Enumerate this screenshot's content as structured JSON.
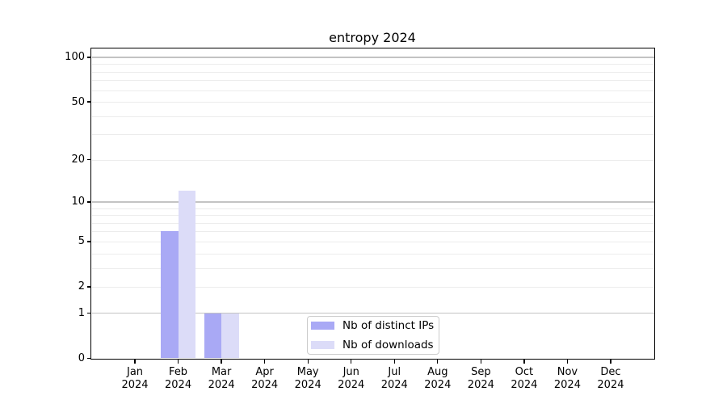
{
  "chart_data": {
    "type": "bar",
    "title": "entropy 2024",
    "categories": [
      "Jan",
      "Feb",
      "Mar",
      "Apr",
      "May",
      "Jun",
      "Jul",
      "Aug",
      "Sep",
      "Oct",
      "Nov",
      "Dec"
    ],
    "year_label": "2024",
    "series": [
      {
        "name": "Nb of distinct IPs",
        "color": "#a9a9f5",
        "values": [
          0,
          6,
          1,
          0,
          0,
          0,
          0,
          0,
          0,
          0,
          0,
          0
        ]
      },
      {
        "name": "Nb of downloads",
        "color": "#dcdcf8",
        "values": [
          0,
          12,
          1,
          0,
          0,
          0,
          0,
          0,
          0,
          0,
          0,
          0
        ]
      }
    ],
    "xlabel": "",
    "ylabel": "",
    "y_axis": {
      "scale": "log10(1+value)",
      "tick_labels": [
        "0",
        "1",
        "2",
        "5",
        "10",
        "20",
        "50",
        "100"
      ],
      "tick_values": [
        0,
        1,
        2,
        5,
        10,
        20,
        50,
        100
      ],
      "ylim": [
        0,
        114
      ]
    },
    "grid": {
      "orientation": "horizontal",
      "minor_color": "#ececec",
      "major_color": "#c3c3c3",
      "major_at": [
        1,
        10,
        100
      ]
    },
    "legend": {
      "position": "lower center"
    }
  },
  "colors": {
    "background": "#ffffff",
    "bar_distinct_ips": "#a9a9f5",
    "bar_downloads": "#dcdcf8",
    "axis": "#000000"
  }
}
